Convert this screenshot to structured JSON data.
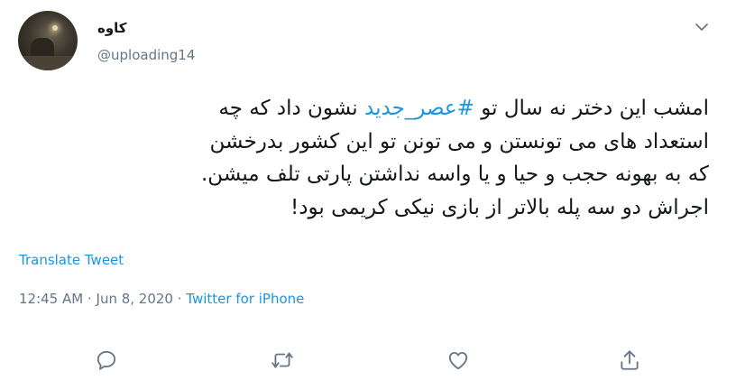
{
  "author": {
    "name": "کاوه",
    "handle": "@uploading14"
  },
  "tweet": {
    "line1_before": "امشب این دختر نه سال تو ",
    "hashtag": "#عصر_جدید",
    "line1_after": " نشون داد که چه",
    "line2": "استعداد های می تونستن و می تونن تو این کشور بدرخشن",
    "line3": "که به بهونه حجب و حیا و یا واسه نداشتن پارتی تلف میشن.",
    "line4": "اجراش دو سه پله بالاتر از بازی نیکی کریمی بود!"
  },
  "translate_label": "Translate Tweet",
  "meta": {
    "time": "12:45 AM",
    "separator": " · ",
    "date": "Jun 8, 2020",
    "source": "Twitter for iPhone"
  },
  "icons": {
    "reply": "reply-icon",
    "retweet": "retweet-icon",
    "like": "like-icon",
    "share": "share-icon",
    "menu": "chevron-down-icon"
  },
  "colors": {
    "link": "#1b95e0",
    "secondary_text": "#657786",
    "primary_text": "#14171a"
  }
}
